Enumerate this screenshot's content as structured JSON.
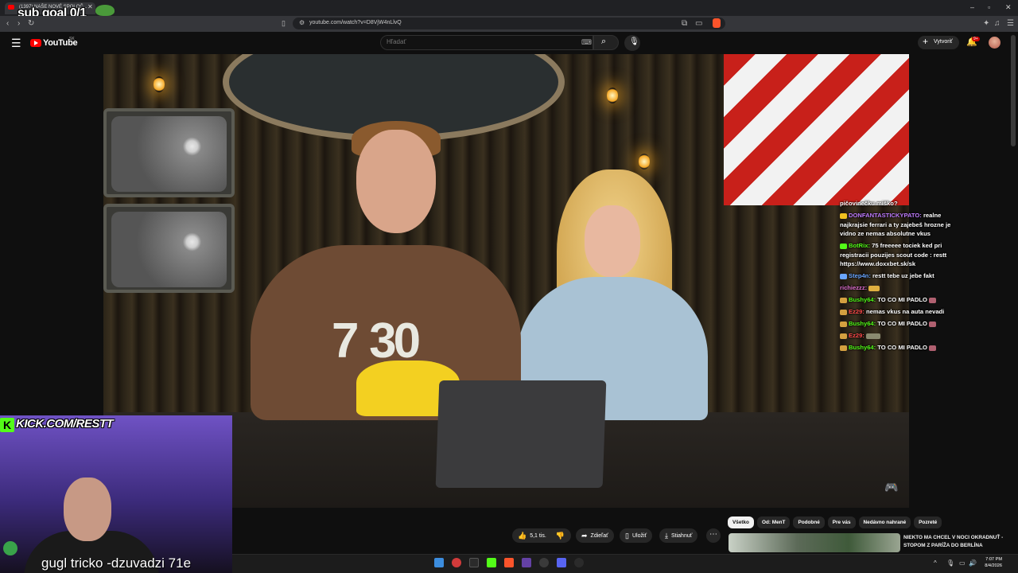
{
  "browser": {
    "tab_title": "(1397) NAŠE NOVÉ SPOLOČ...",
    "url": "youtube.com/watch?v=D8VjW4nLlvQ"
  },
  "stream_overlay": {
    "sub_goal": "sub goal 0/1",
    "kick_url": "KICK.COM/RESTT",
    "caption": "gugl tricko -dzuvadzi 71e"
  },
  "youtube": {
    "logo": "YouTube",
    "region": "SK",
    "search_placeholder": "Hľadať",
    "create_label": "Vytvoriť",
    "notification_badge": "9+"
  },
  "video": {
    "tshirt_text": "7 30"
  },
  "actions": {
    "like_count": "5,1 tis.",
    "share_label": "Zdieľať",
    "save_label": "Uložiť",
    "download_label": "Stiahnuť"
  },
  "chat": [
    {
      "user": "",
      "text": "pičovinečku miško?",
      "color": "#ffffff"
    },
    {
      "user": "DONFANTASTICKYPATO:",
      "text": " realne najkrajsie ferrari a ty zajebeš hrozne je vidno ze nemas absolutne vkus",
      "color": "#c07cff"
    },
    {
      "user": "BotRix:",
      "text": " 75 freeeee tociek ked pri registracii pouzijes scout code : restt https://www.doxxbet.sk/sk",
      "color": "#53fc18"
    },
    {
      "user": "Step4n:",
      "text": " restt tebe uz jebe fakt",
      "color": "#6aa6ff"
    },
    {
      "user": "richiezzz:",
      "text": "",
      "color": "#e070d0"
    },
    {
      "user": "Bushy64:",
      "text": " TO CO MI PADLO",
      "color": "#53fc18"
    },
    {
      "user": "Ez29:",
      "text": " nemas vkus na auta nevadi",
      "color": "#ff4b4b"
    },
    {
      "user": "Bushy64:",
      "text": " TO CO MI PADLO",
      "color": "#53fc18"
    },
    {
      "user": "Ez29:",
      "text": "",
      "color": "#ff4b4b"
    },
    {
      "user": "Bushy64:",
      "text": " TO CO MI PADLO",
      "color": "#53fc18"
    }
  ],
  "chips": [
    "Všetko",
    "Od: MenT",
    "Podobné",
    "Pre vás",
    "Nedávno nahrané",
    "Pozreté"
  ],
  "recommendation": {
    "title": "NIEKTO MA CHCEL V NOCI OKRADNUŤ - STOPOM Z PARÍŽA DO BERLÍNA"
  },
  "taskbar": {
    "time": "7:07 PM",
    "date": "8/4/2026"
  }
}
